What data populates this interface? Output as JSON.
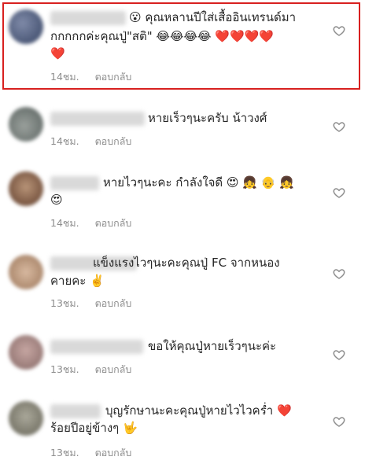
{
  "comments": [
    {
      "line1": "😮 คุณหลานปีใส่เสื้ออินเทรนด์มา",
      "line2": "กกกกกค่ะคุณปู่\"สติ\" 😂😂😂😂 ❤️❤️❤️❤️",
      "line3": "❤️",
      "time": "14ชม.",
      "reply": "ตอบกลับ"
    },
    {
      "line1": "หายเร็วๆนะครับ น้าวงศ์",
      "time": "14ชม.",
      "reply": "ตอบกลับ"
    },
    {
      "line1": "หายไวๆนะคะ กำลังใจดี 😍 👧 👴 👧",
      "line2": "😍",
      "time": "14ชม.",
      "reply": "ตอบกลับ"
    },
    {
      "line1": "แข็งแรงไวๆนะคะคุณปู่ FC จากหนอง",
      "line2": "คายคะ ✌️",
      "time": "13ชม.",
      "reply": "ตอบกลับ"
    },
    {
      "line1": "ขอให้คุณปู่หายเร็วๆนะค่ะ",
      "time": "13ชม.",
      "reply": "ตอบกลับ"
    },
    {
      "line1": "บุญรักษานะคะคุณปู่หายไวไวคร่ำ ❤️",
      "line2": "ร้อยปีอยู่ข้างๆ 🤟",
      "time": "13ชม.",
      "reply": "ตอบกลับ"
    }
  ],
  "colors": {
    "highlight_border": "#d8201f",
    "secondary_text": "#8e8e8e"
  },
  "icons": {
    "like": "heart-outline-icon"
  }
}
